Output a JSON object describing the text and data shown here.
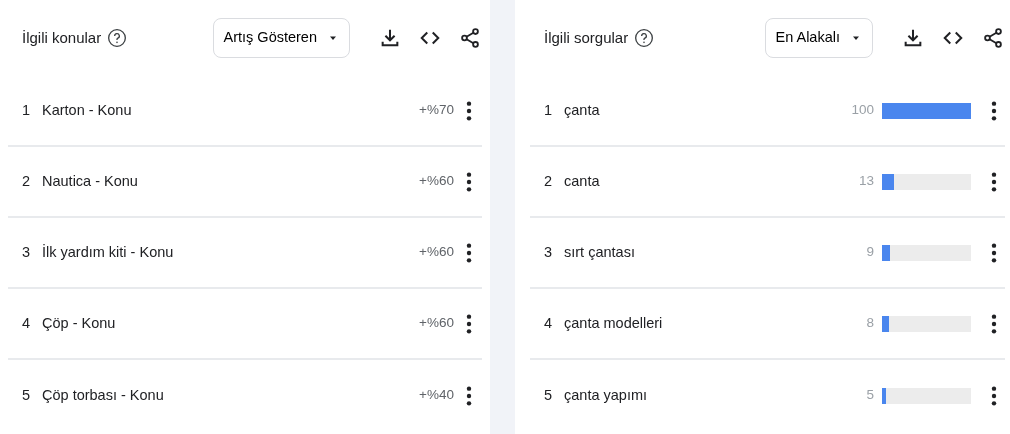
{
  "panels": [
    {
      "title": "İlgili konular",
      "dropdown": "Artış Gösteren",
      "rows": [
        {
          "kind": "percent",
          "rank": "1",
          "label": "Karton - Konu",
          "value": "+%70"
        },
        {
          "kind": "percent",
          "rank": "2",
          "label": "Nautica - Konu",
          "value": "+%60"
        },
        {
          "kind": "percent",
          "rank": "3",
          "label": "İlk yardım kiti - Konu",
          "value": "+%60"
        },
        {
          "kind": "percent",
          "rank": "4",
          "label": "Çöp - Konu",
          "value": "+%60"
        },
        {
          "kind": "percent",
          "rank": "5",
          "label": "Çöp torbası - Konu",
          "value": "+%40"
        }
      ]
    },
    {
      "title": "İlgili sorgular",
      "dropdown": "En Alakalı",
      "rows": [
        {
          "kind": "meter",
          "rank": "1",
          "label": "çanta",
          "value": "100",
          "level": 1
        },
        {
          "kind": "meter",
          "rank": "2",
          "label": "canta",
          "value": "13",
          "level": 0.13
        },
        {
          "kind": "meter",
          "rank": "3",
          "label": "sırt çantası",
          "value": "9",
          "level": 0.09
        },
        {
          "kind": "meter",
          "rank": "4",
          "label": "çanta modelleri",
          "value": "8",
          "level": 0.08
        },
        {
          "kind": "meter",
          "rank": "5",
          "label": "çanta yapımı",
          "value": "5",
          "level": 0.05
        }
      ]
    }
  ]
}
